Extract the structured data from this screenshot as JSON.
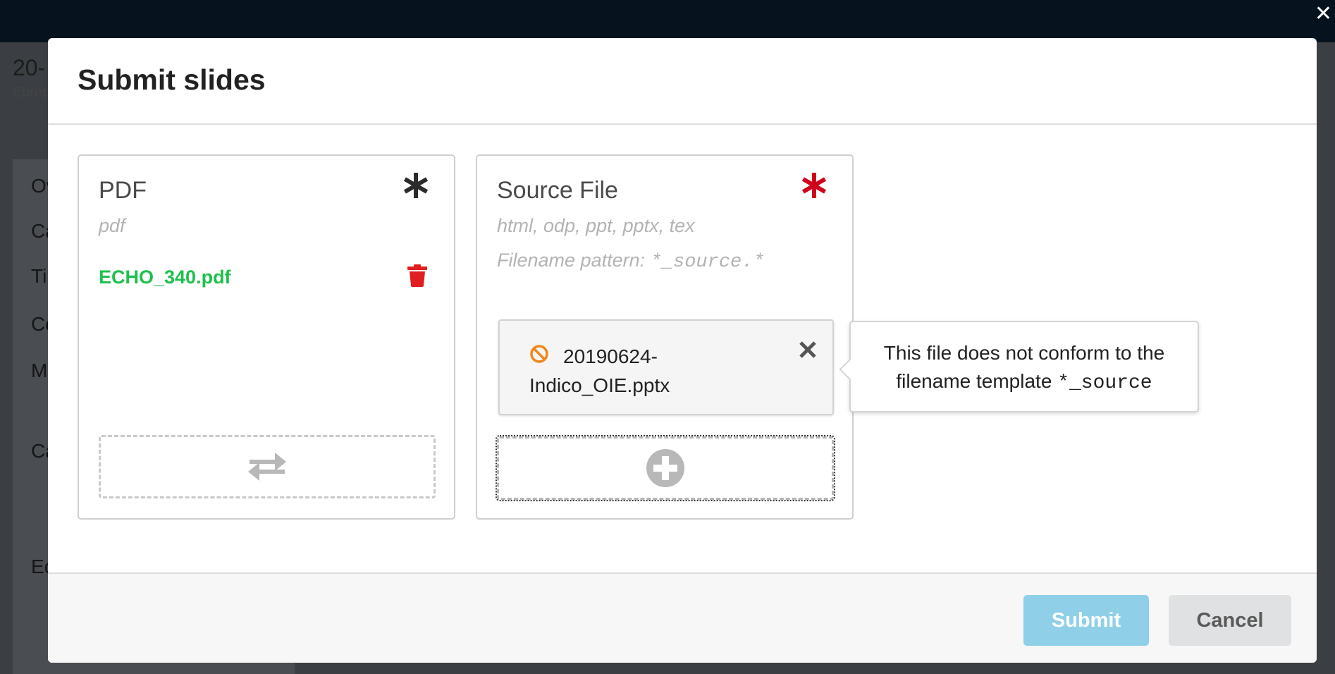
{
  "background": {
    "page_title_fragment": "20-",
    "page_subtitle_fragment": "Europ",
    "side_items": [
      "Ov",
      "Ca",
      "Ti",
      "Co",
      "M",
      "Ca",
      "Ec"
    ]
  },
  "modal": {
    "title": "Submit slides",
    "pdf": {
      "title": "PDF",
      "extensions": "pdf",
      "file_name": "ECHO_340.pdf",
      "required_color": "#2b2b2b"
    },
    "source": {
      "title": "Source File",
      "extensions": "html, odp, ppt, pptx, tex",
      "pattern_label": "Filename pattern: ",
      "pattern_value": "*_source.*",
      "pending_file": "20190624-Indico_OIE.pptx",
      "required_color": "#d0021b"
    },
    "tooltip": {
      "text": "This file does not conform to the filename template ",
      "code": "*_source"
    },
    "footer": {
      "submit_label": "Submit",
      "cancel_label": "Cancel"
    }
  },
  "colors": {
    "accent_submit": "#8fd0e8",
    "file_ok": "#1fc04d",
    "trash": "#e02020",
    "warning": "#f2871b"
  }
}
